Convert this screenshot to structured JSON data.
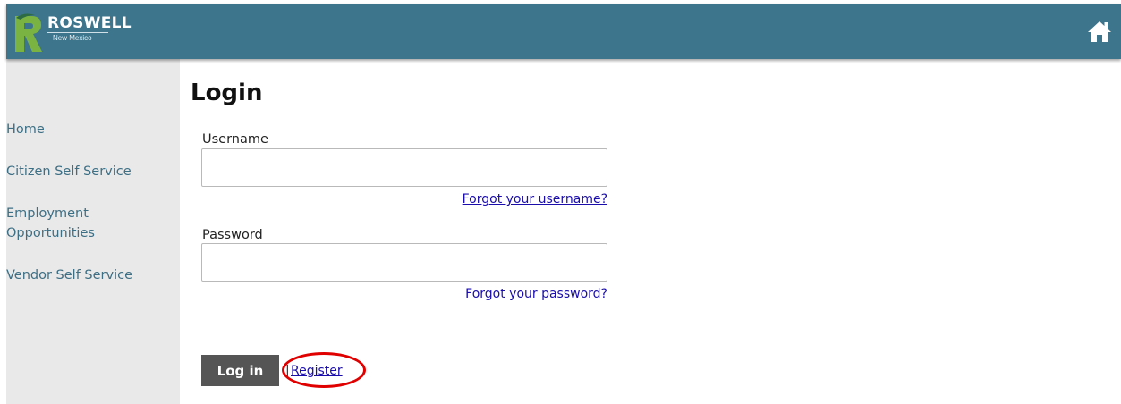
{
  "brand": {
    "name": "ROSWELL",
    "subtitle": "New Mexico",
    "header_color": "#3d758c",
    "logo_green": "#7bb342"
  },
  "header": {
    "home_icon": "home-icon"
  },
  "sidebar": {
    "items": [
      {
        "label": "Home"
      },
      {
        "label": "Citizen Self Service"
      },
      {
        "label": "Employment Opportunities"
      },
      {
        "label": "Vendor Self Service"
      }
    ]
  },
  "main": {
    "title": "Login",
    "username_label": "Username",
    "username_value": "",
    "forgot_username": "Forgot your username?",
    "password_label": "Password",
    "password_value": "",
    "forgot_password": "Forgot your password?",
    "login_button": "Log in",
    "separator": "|",
    "register_link": "Register",
    "annotation_color": "#e00000"
  }
}
